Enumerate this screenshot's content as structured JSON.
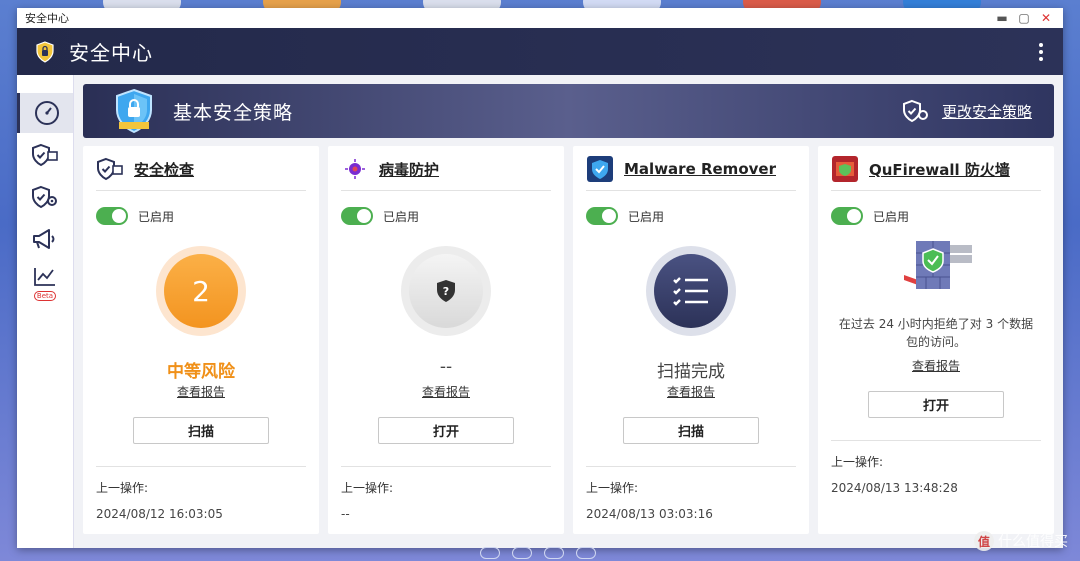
{
  "window": {
    "title": "安全中心"
  },
  "app": {
    "title": "安全中心"
  },
  "sidebar": {
    "items": [
      {
        "icon": "dashboard-icon"
      },
      {
        "icon": "shield-check-icon"
      },
      {
        "icon": "shield-gear-icon"
      },
      {
        "icon": "megaphone-icon"
      },
      {
        "icon": "chart-line-icon",
        "badge": "Beta"
      }
    ]
  },
  "banner": {
    "title": "基本安全策略",
    "change_link": "更改安全策略"
  },
  "cards": [
    {
      "title": "安全检查",
      "enabled_label": "已启用",
      "risk_count": "2",
      "status": "中等风险",
      "report_link": "查看报告",
      "button": "扫描",
      "last_action_label": "上一操作:",
      "last_action_time": "2024/08/12 16:03:05"
    },
    {
      "title": "病毒防护",
      "enabled_label": "已启用",
      "status": "--",
      "report_link": "查看报告",
      "button": "打开",
      "last_action_label": "上一操作:",
      "last_action_time": "--"
    },
    {
      "title": "Malware Remover",
      "enabled_label": "已启用",
      "status": "扫描完成",
      "report_link": "查看报告",
      "button": "扫描",
      "last_action_label": "上一操作:",
      "last_action_time": "2024/08/13 03:03:16"
    },
    {
      "title": "QuFirewall 防火墙",
      "enabled_label": "已启用",
      "description": "在过去 24 小时内拒绝了对 3 个数据包的访问。",
      "report_link": "查看报告",
      "button": "打开",
      "last_action_label": "上一操作:",
      "last_action_time": "2024/08/13 13:48:28"
    }
  ],
  "watermark": {
    "text": "什么值得买",
    "icon_text": "值"
  },
  "colors": {
    "accent_dark": "#2c3258",
    "toggle_on": "#4caf50",
    "risk_orange": "#f09018"
  }
}
